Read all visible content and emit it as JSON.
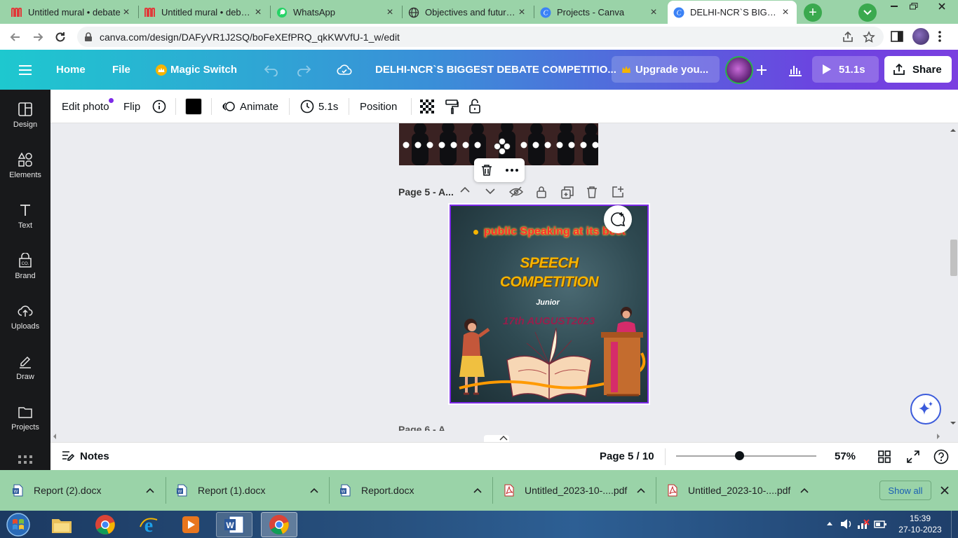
{
  "browser": {
    "tabs": [
      {
        "title": "Untitled mural • debate",
        "icon": "mural-icon"
      },
      {
        "title": "Untitled mural • debate",
        "icon": "mural-icon"
      },
      {
        "title": "WhatsApp",
        "icon": "whatsapp-icon"
      },
      {
        "title": "Objectives and future p",
        "icon": "globe-icon"
      },
      {
        "title": "Projects - Canva",
        "icon": "canva-icon"
      },
      {
        "title": "DELHI-NCR`S BIGGEST",
        "icon": "canva-icon",
        "active": true
      }
    ],
    "url": "canva.com/design/DAFyVR1J2SQ/boFeXEfPRQ_qkKWVfU-1_w/edit"
  },
  "topbar": {
    "home": "Home",
    "file": "File",
    "magic_switch": "Magic Switch",
    "doc_title": "DELHI-NCR`S BIGGEST DEBATE COMPETITIO...",
    "upgrade": "Upgrade you...",
    "present_time": "51.1s",
    "share": "Share"
  },
  "sidebar": {
    "items": [
      {
        "label": "Design",
        "icon": "design-icon"
      },
      {
        "label": "Elements",
        "icon": "elements-icon"
      },
      {
        "label": "Text",
        "icon": "text-icon"
      },
      {
        "label": "Brand",
        "icon": "brand-icon"
      },
      {
        "label": "Uploads",
        "icon": "uploads-icon"
      },
      {
        "label": "Draw",
        "icon": "draw-icon"
      },
      {
        "label": "Projects",
        "icon": "projects-icon"
      }
    ]
  },
  "toolbar": {
    "edit_photo": "Edit photo",
    "flip": "Flip",
    "animate": "Animate",
    "duration": "5.1s",
    "position": "Position",
    "color_swatch": "#000000"
  },
  "canvas": {
    "page_label": "Page 5 - A...",
    "next_page_label": "Page 6 - A...",
    "design": {
      "bullet_text": "public Speaking at its best",
      "title_line1": "SPEECH",
      "title_line2": "COMPETITION",
      "subtitle": "Junior",
      "date": "17th AUGUST2023"
    }
  },
  "footer": {
    "notes": "Notes",
    "page_indicator": "Page 5 / 10",
    "zoom": "57%",
    "zoom_level": 0.45
  },
  "downloads": {
    "items": [
      {
        "name": "Report (2).docx",
        "type": "docx"
      },
      {
        "name": "Report (1).docx",
        "type": "docx"
      },
      {
        "name": "Report.docx",
        "type": "docx"
      },
      {
        "name": "Untitled_2023-10-....pdf",
        "type": "pdf"
      },
      {
        "name": "Untitled_2023-10-....pdf",
        "type": "pdf"
      }
    ],
    "show_all": "Show all"
  },
  "taskbar": {
    "time": "15:39",
    "date": "27-10-2023"
  },
  "colors": {
    "accent": "#7d2ae8",
    "tabbar": "#9ad3a8",
    "sidebar": "#18191b"
  }
}
